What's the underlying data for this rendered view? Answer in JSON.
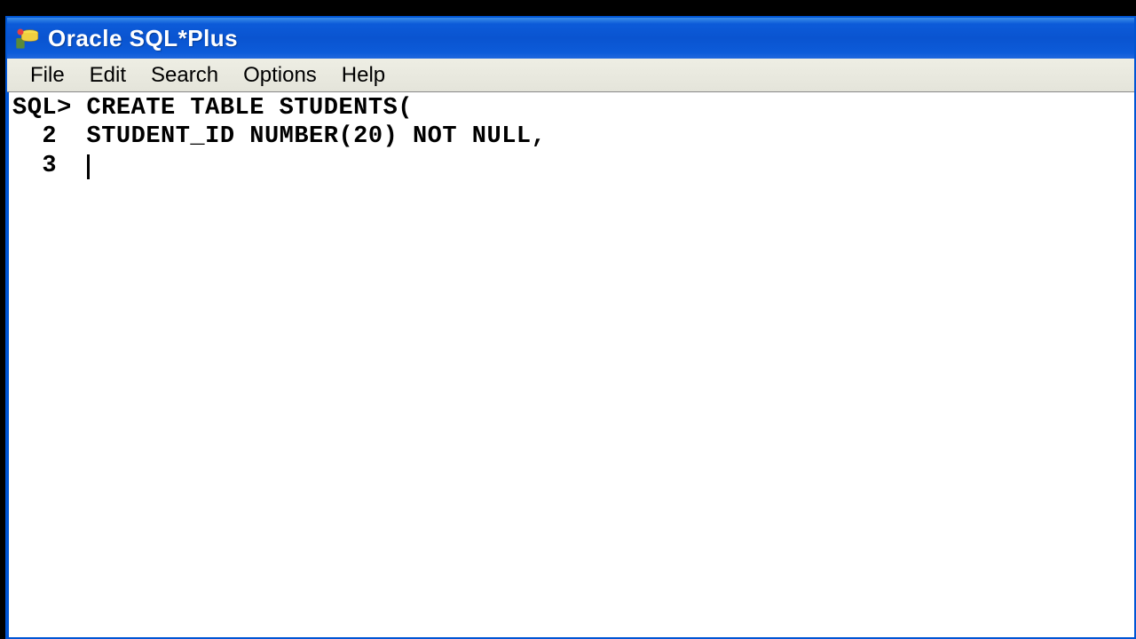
{
  "window": {
    "title": "Oracle SQL*Plus"
  },
  "menu": {
    "items": [
      "File",
      "Edit",
      "Search",
      "Options",
      "Help"
    ]
  },
  "terminal": {
    "prompt": "SQL>",
    "lines": [
      {
        "lineno": "",
        "prefix": "SQL> ",
        "text": "CREATE TABLE STUDENTS("
      },
      {
        "lineno": "  2  ",
        "prefix": "",
        "text": "STUDENT_ID NUMBER(20) NOT NULL,"
      },
      {
        "lineno": "  3  ",
        "prefix": "",
        "text": ""
      }
    ]
  }
}
